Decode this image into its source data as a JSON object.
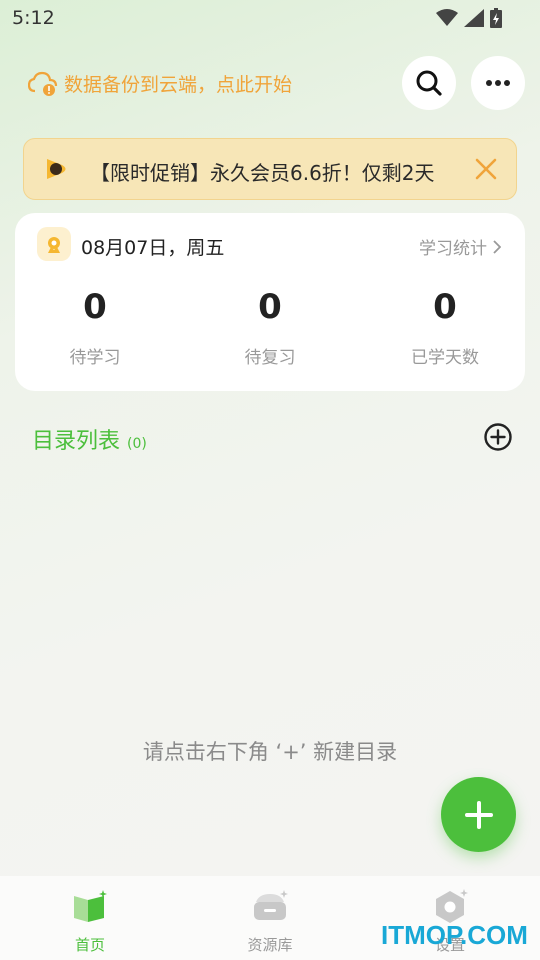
{
  "status_bar": {
    "time": "5:12"
  },
  "header": {
    "backup_text": "数据备份到云端，点此开始",
    "icons": [
      "cloud-warning-icon",
      "search-icon",
      "more-icon"
    ]
  },
  "promo": {
    "text": "【限时促销】永久会员6.6折！仅剩2天",
    "icon": "megaphone-icon"
  },
  "summary": {
    "date": "08月07日，周五",
    "stats_link": "学习统计",
    "stats": [
      {
        "value": "0",
        "label": "待学习"
      },
      {
        "value": "0",
        "label": "待复习"
      },
      {
        "value": "0",
        "label": "已学天数"
      }
    ]
  },
  "directory": {
    "title": "目录列表",
    "count": "(0)",
    "empty_hint": "请点击右下角 ‘+’ 新建目录"
  },
  "bottom_nav": {
    "items": [
      {
        "label": "首页",
        "icon": "book-icon",
        "active": true
      },
      {
        "label": "资源库",
        "icon": "box-icon",
        "active": false
      },
      {
        "label": "设置",
        "icon": "settings-icon",
        "active": false
      }
    ]
  },
  "watermark": "ITMOP.COM",
  "colors": {
    "accent": "#4cbf3c",
    "warning": "#f0a43a",
    "promo_bg": "#f7e6b7"
  }
}
